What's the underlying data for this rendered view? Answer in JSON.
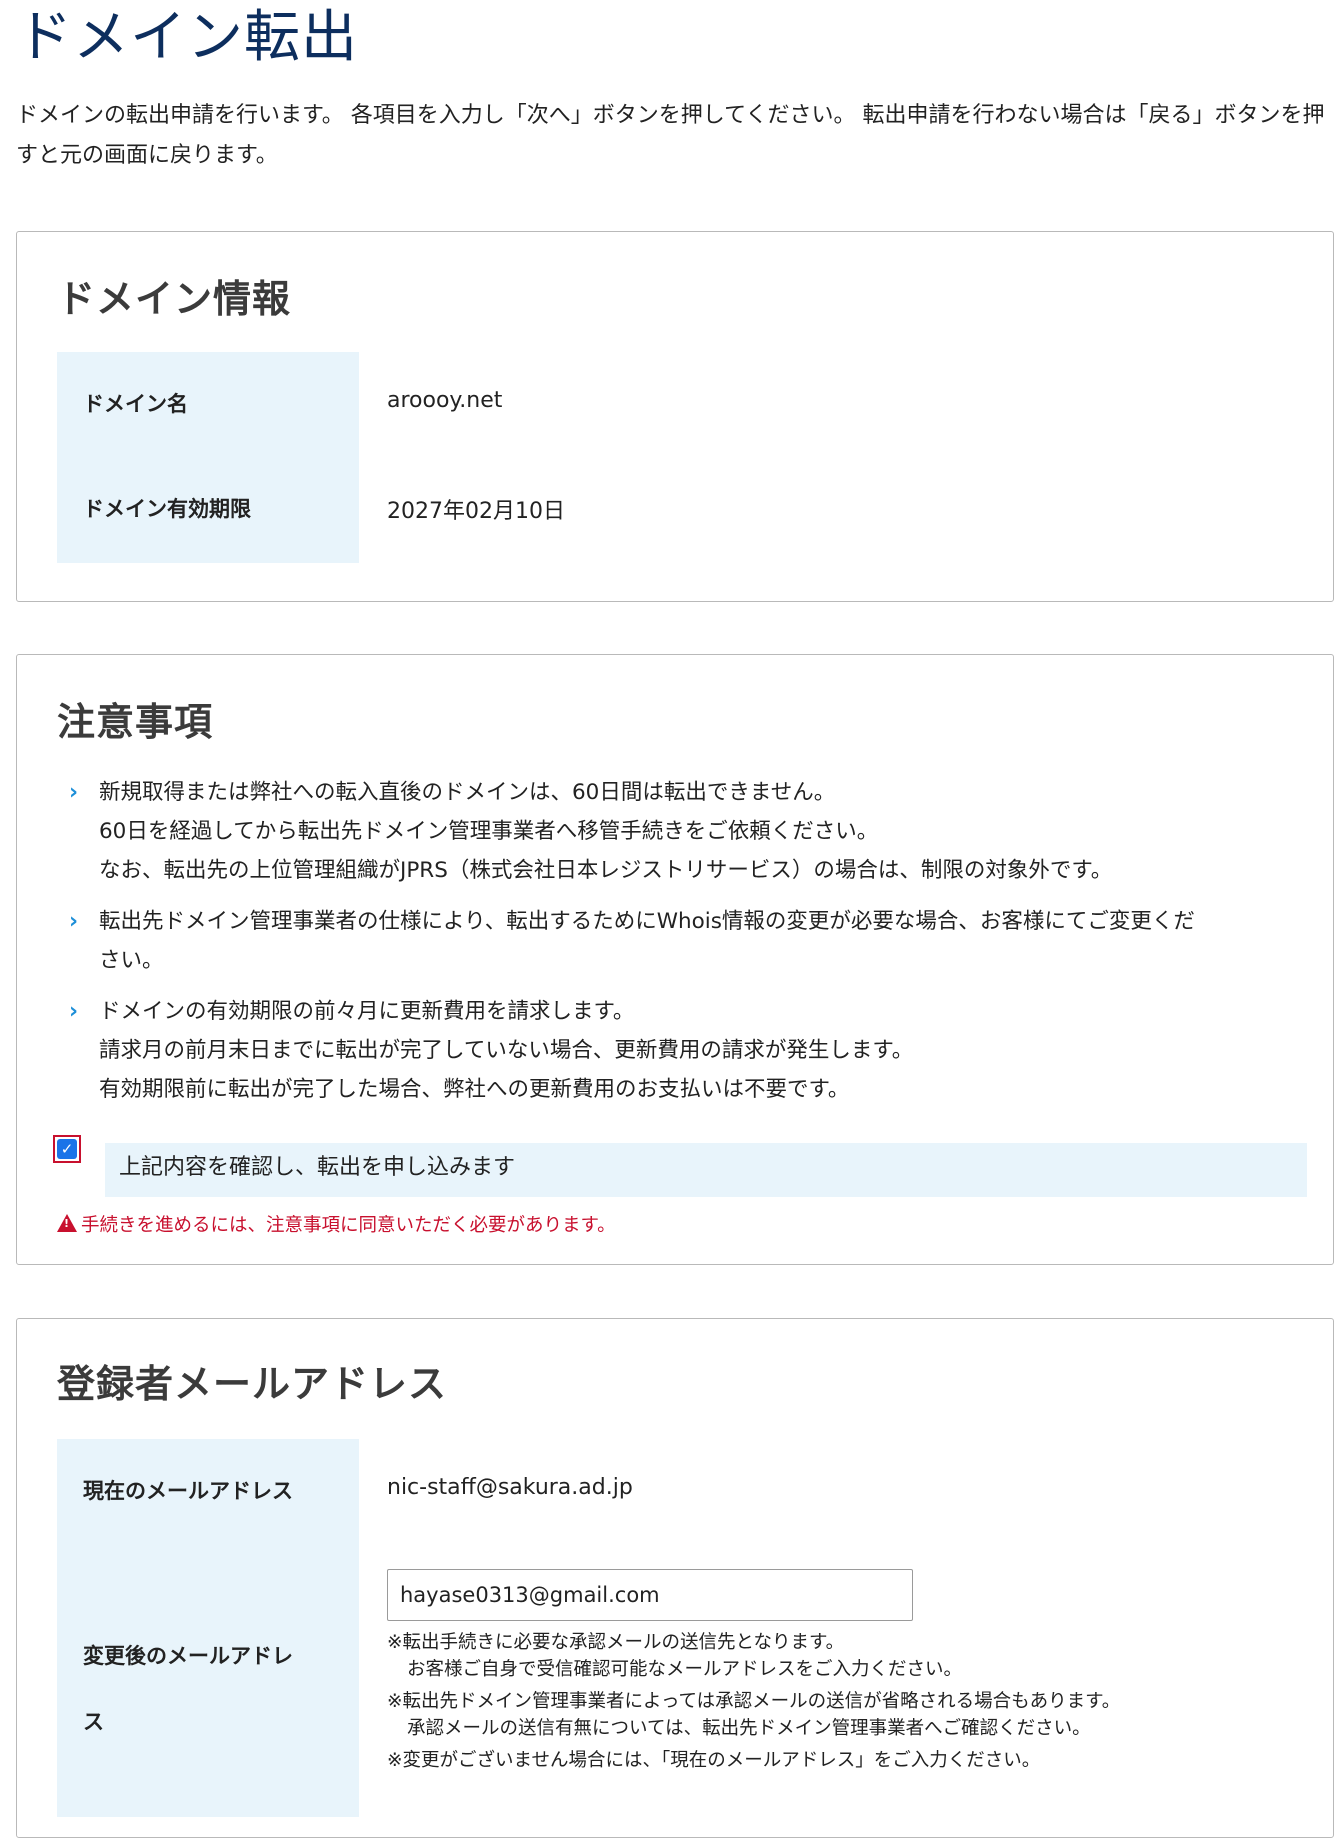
{
  "page": {
    "title": "ドメイン転出",
    "lead": "ドメインの転出申請を行います。 各項目を入力し「次へ」ボタンを押してください。 転出申請を行わない場合は「戻る」ボタンを押すと元の画面に戻ります。"
  },
  "domain_info": {
    "heading": "ドメイン情報",
    "rows": [
      {
        "label": "ドメイン名",
        "value": "aroooy.net"
      },
      {
        "label": "ドメイン有効期限",
        "value": "2027年02月10日"
      }
    ]
  },
  "notes": {
    "heading": "注意事項",
    "items": [
      {
        "lines": [
          "新規取得または弊社への転入直後のドメインは、60日間は転出できません。",
          "60日を経過してから転出先ドメイン管理事業者へ移管手続きをご依頼ください。",
          "なお、転出先の上位管理組織がJPRS（株式会社日本レジストリサービス）の場合は、制限の対象外です。"
        ]
      },
      {
        "lines": [
          "転出先ドメイン管理事業者の仕様により、転出するためにWhois情報の変更が必要な場合、お客様にてご変更くだ",
          "さい。"
        ]
      },
      {
        "lines": [
          "ドメインの有効期限の前々月に更新費用を請求します。",
          "請求月の前月末日までに転出が完了していない場合、更新費用の請求が発生します。",
          "有効期限前に転出が完了した場合、弊社への更新費用のお支払いは不要です。"
        ]
      }
    ],
    "agree_label": "上記内容を確認し、転出を申し込みます",
    "agree_checked": true,
    "warning": "手続きを進めるには、注意事項に同意いただく必要があります。",
    "accent_color": "#1d8fd8",
    "error_color": "#c8102e"
  },
  "email": {
    "heading": "登録者メールアドレス",
    "current_label": "現在のメールアドレス",
    "current_value": "nic-staff@sakura.ad.jp",
    "new_label_line1": "変更後のメールアドレ",
    "new_label_line2": "ス",
    "new_value": "hayase0313@gmail.com",
    "hints": [
      {
        "main": "※転出手続きに必要な承認メールの送信先となります。",
        "sub": "お客様ご自身で受信確認可能なメールアドレスをご入力ください。"
      },
      {
        "main": "※転出先ドメイン管理事業者によっては承認メールの送信が省略される場合もあります。",
        "sub": "承認メールの送信有無については、転出先ドメイン管理事業者へご確認ください。"
      },
      {
        "main": "※変更がございません場合には、「現在のメールアドレス」をご入力ください。",
        "sub": ""
      }
    ]
  }
}
